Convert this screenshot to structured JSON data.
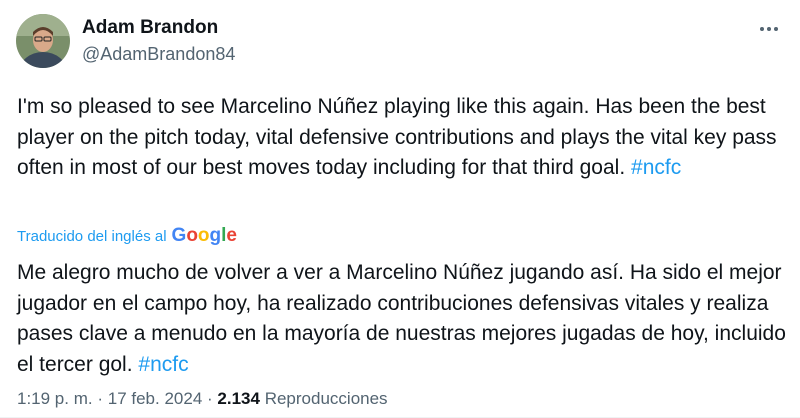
{
  "author": {
    "display_name": "Adam Brandon",
    "handle": "@AdamBrandon84"
  },
  "tweet": {
    "text_before": "I'm so pleased to see Marcelino Núñez playing like this again. Has been the best player on the pitch today, vital defensive contributions and plays the vital key pass often in most of our best moves today including for that third goal. ",
    "hashtag": "#ncfc"
  },
  "translation": {
    "label": "Traducido del inglés al",
    "provider": "Google",
    "text_before": "Me alegro mucho de volver a ver a Marcelino Núñez jugando así. Ha sido el mejor jugador en el campo hoy, ha realizado contribuciones defensivas vitales y realiza pases clave a menudo en la mayoría de nuestras mejores jugadas de hoy, incluido el tercer gol. ",
    "hashtag": "#ncfc"
  },
  "meta": {
    "time": "1:19 p. m.",
    "separator": "·",
    "date": "17 feb. 2024",
    "views_count": "2.134",
    "views_label": "Reproducciones"
  },
  "icons": {
    "more": "more-horizontal-icon"
  },
  "colors": {
    "accent": "#1d9bf0",
    "text": "#0f1419",
    "secondary": "#536471"
  }
}
